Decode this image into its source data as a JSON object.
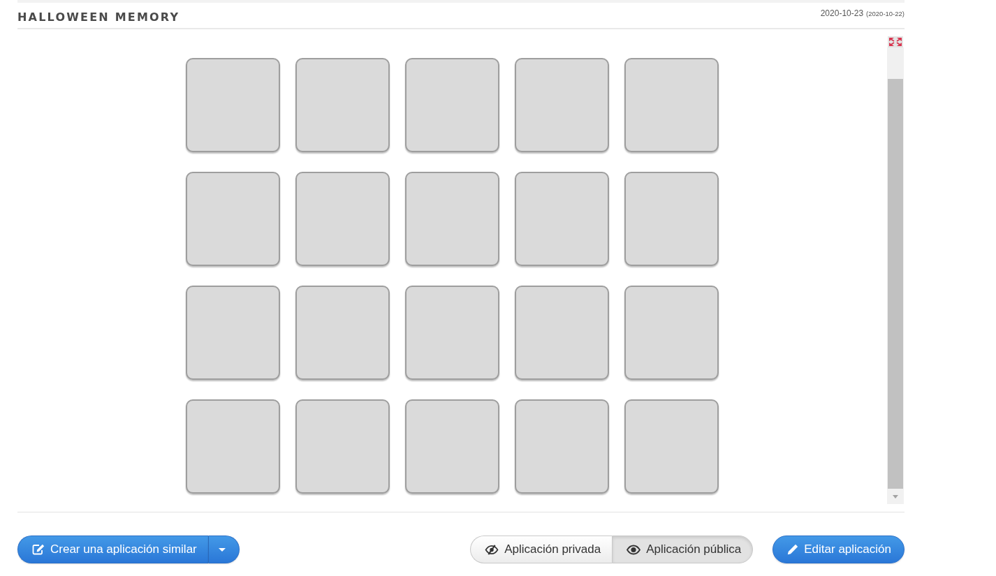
{
  "header": {
    "title": "HALLOWEEN MEMORY",
    "date": "2020-10-23",
    "original_date": "(2020-10-22)"
  },
  "board": {
    "rows": [
      {
        "cards": [
          {
            "kind": "back"
          },
          {
            "kind": "back"
          },
          {
            "kind": "back"
          },
          {
            "kind": "back"
          },
          {
            "kind": "back"
          }
        ]
      },
      {
        "cards": [
          {
            "kind": "back"
          },
          {
            "kind": "back"
          },
          {
            "kind": "back"
          },
          {
            "kind": "back"
          },
          {
            "kind": "back"
          }
        ]
      },
      {
        "cards": [
          {
            "kind": "back"
          },
          {
            "kind": "back"
          },
          {
            "kind": "back"
          },
          {
            "kind": "back"
          },
          {
            "kind": "back"
          }
        ]
      },
      {
        "cards": [
          {
            "kind": "back"
          },
          {
            "kind": "back"
          },
          {
            "kind": "back"
          },
          {
            "kind": "back"
          },
          {
            "kind": "back"
          }
        ]
      }
    ]
  },
  "actions": {
    "create_button": {
      "label": "Crear una aplicación similar"
    },
    "visibility": [
      {
        "kind": "private",
        "label": "Aplicación privada",
        "selected": false
      },
      {
        "kind": "public",
        "label": "Aplicación pública",
        "selected": true
      }
    ],
    "edit_button": {
      "label": "Editar aplicación"
    }
  }
}
